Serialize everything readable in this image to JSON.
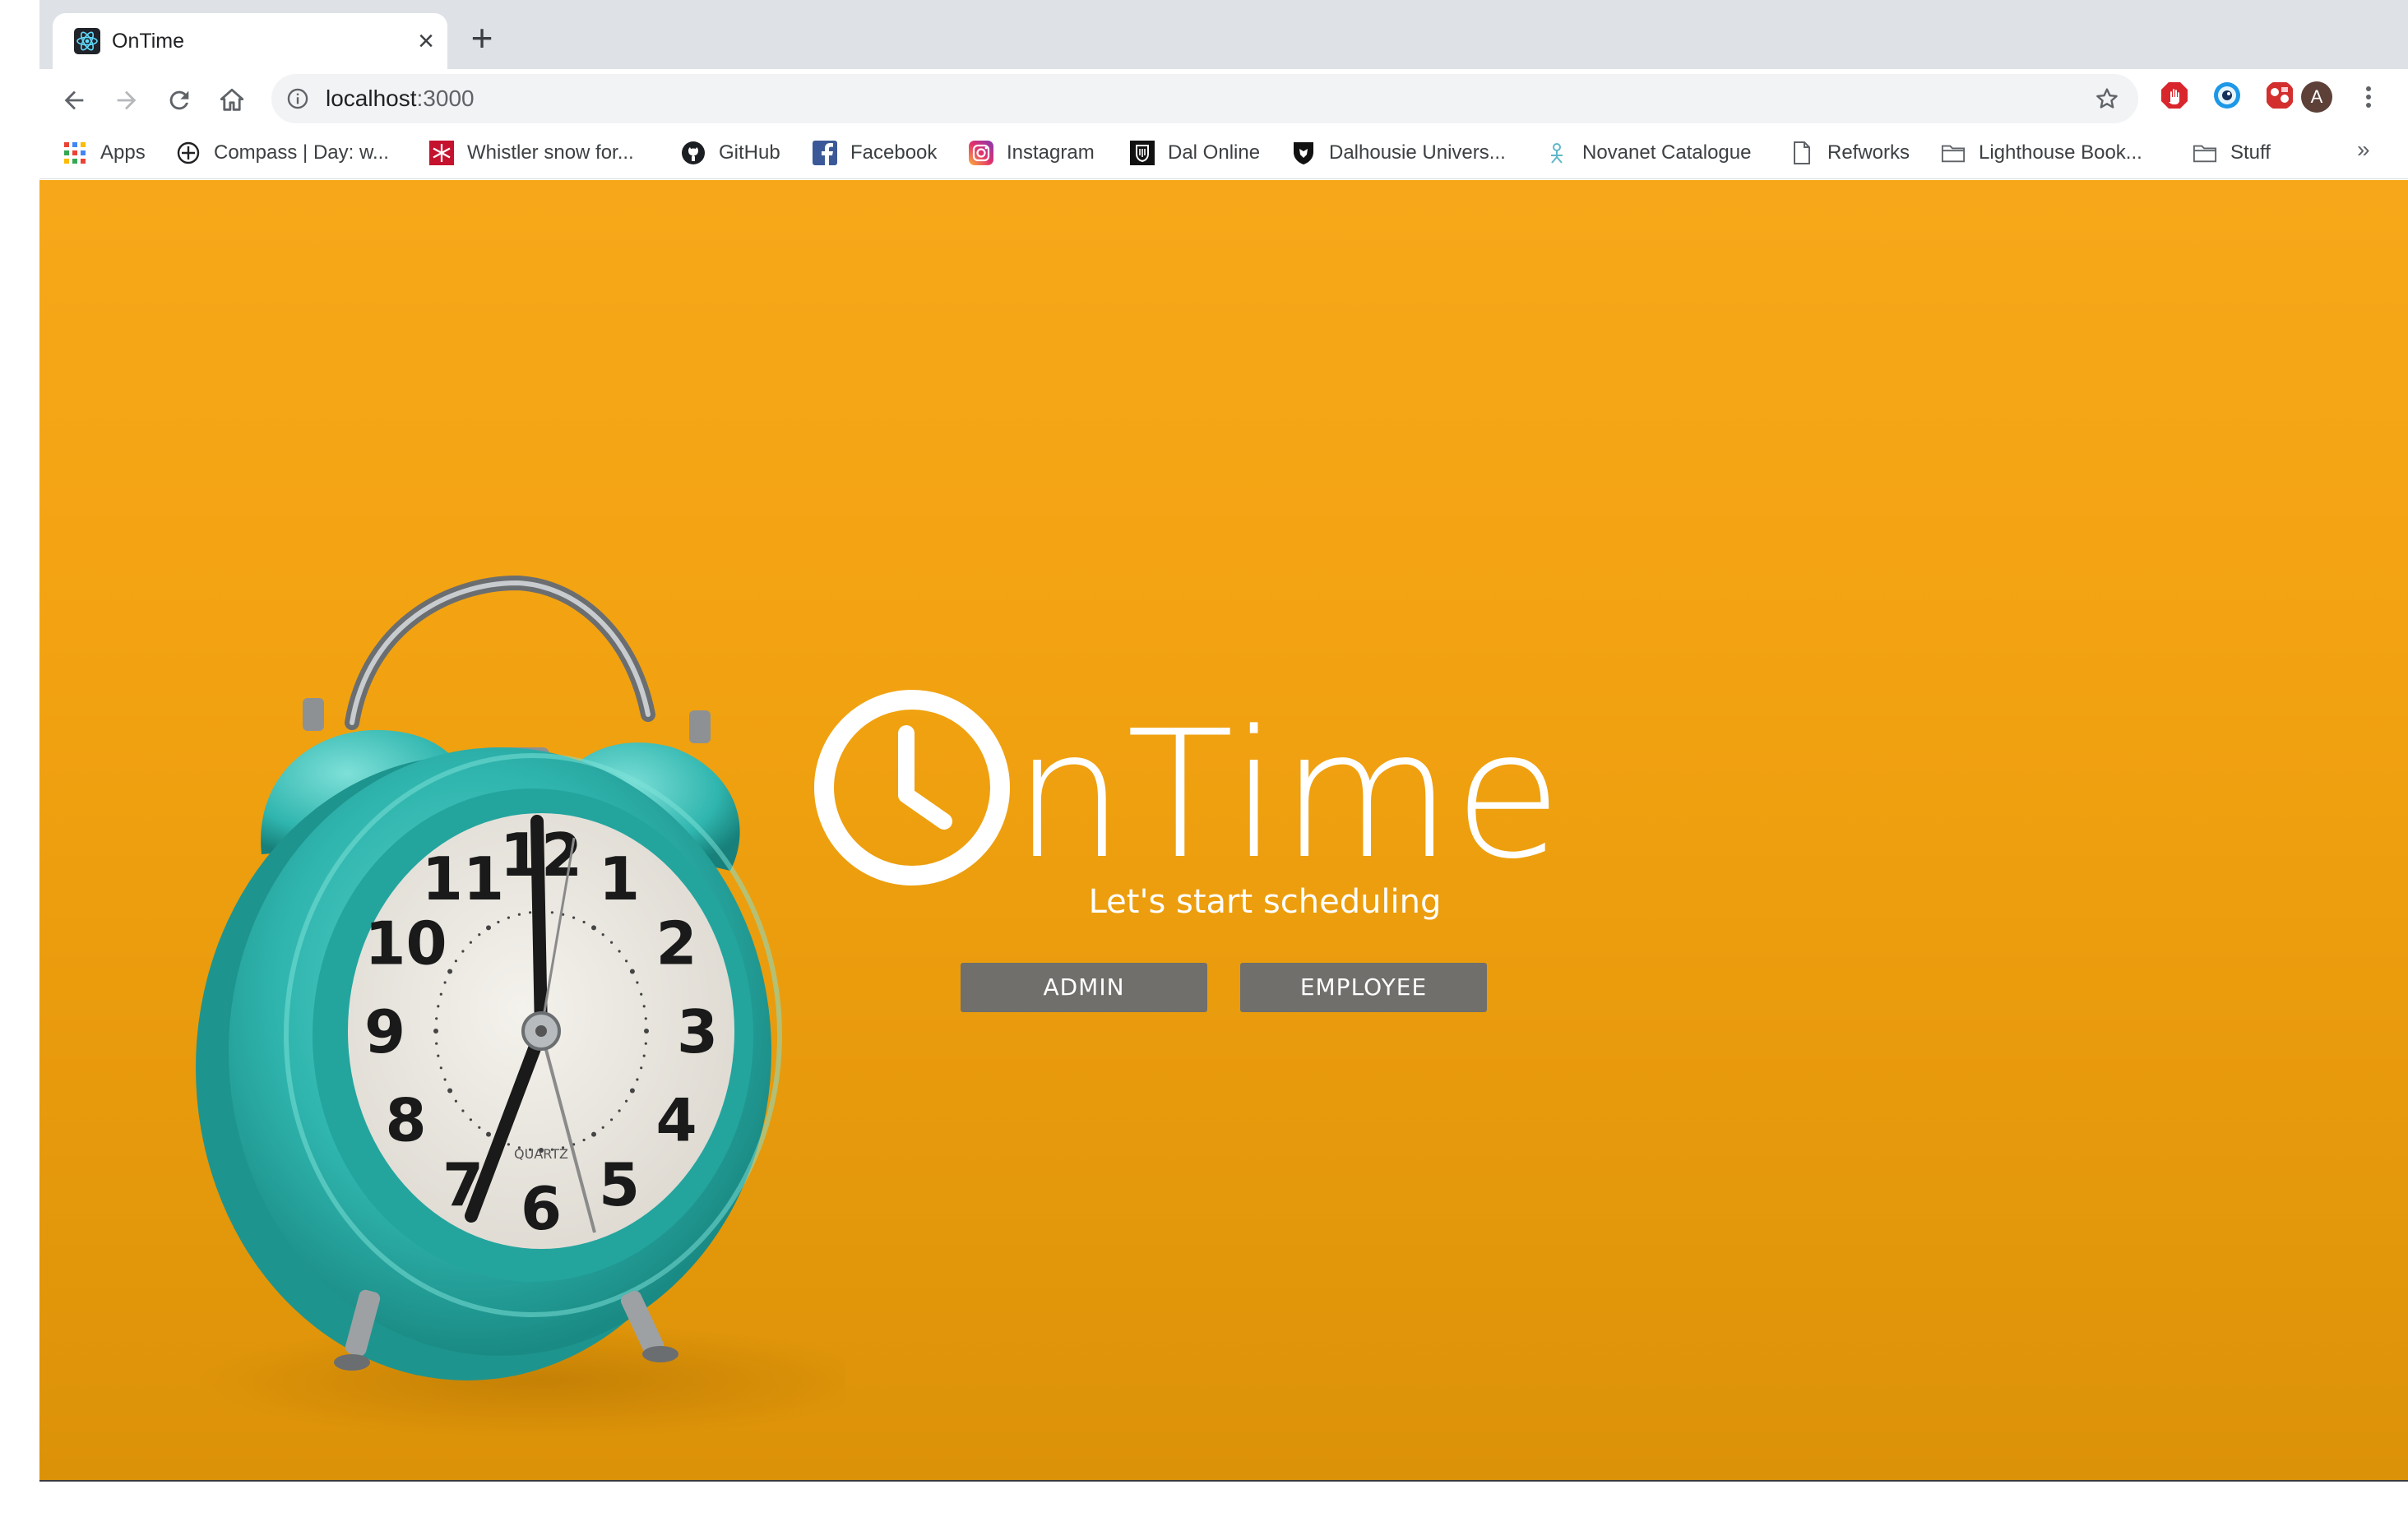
{
  "browser": {
    "tab": {
      "title": "OnTime",
      "favicon": "react-icon",
      "close_glyph": "×"
    },
    "new_tab_glyph": "+",
    "address": {
      "host": "localhost",
      "port": ":3000"
    },
    "avatar_initial": "A",
    "more_glyph": "»"
  },
  "bookmarks": [
    {
      "label": "Apps",
      "icon": "apps-grid-icon"
    },
    {
      "label": "Compass | Day: w...",
      "icon": "compass-icon"
    },
    {
      "label": "Whistler snow for...",
      "icon": "snowflake-icon"
    },
    {
      "label": "GitHub",
      "icon": "github-icon"
    },
    {
      "label": "Facebook",
      "icon": "facebook-icon"
    },
    {
      "label": "Instagram",
      "icon": "instagram-icon"
    },
    {
      "label": "Dal Online",
      "icon": "dal-online-icon"
    },
    {
      "label": "Dalhousie Univers...",
      "icon": "dalhousie-shield-icon"
    },
    {
      "label": "Novanet Catalogue",
      "icon": "novanet-icon"
    },
    {
      "label": "Refworks",
      "icon": "page-icon"
    },
    {
      "label": "Lighthouse Book...",
      "icon": "folder-icon"
    },
    {
      "label": "Stuff",
      "icon": "folder-icon"
    }
  ],
  "hero": {
    "brand_rest": "nTime",
    "tagline": "Let's start scheduling",
    "admin_label": "ADMIN",
    "employee_label": "EMPLOYEE"
  },
  "clock_face": {
    "numerals": [
      "12",
      "1",
      "2",
      "3",
      "4",
      "5",
      "6",
      "7",
      "8",
      "9",
      "10",
      "11"
    ],
    "brand_mark": "QUARTZ"
  },
  "colors": {
    "background": "#f3a311",
    "clock_body": "#2fb5ae",
    "button": "#706f6c"
  }
}
